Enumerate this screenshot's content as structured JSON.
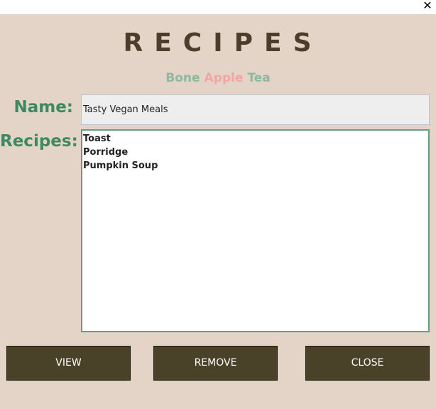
{
  "window": {
    "close_glyph": "✕"
  },
  "header": {
    "title": "RECIPES",
    "subtitle": {
      "word1": "Bone",
      "word2": "Apple",
      "word3": "Tea"
    }
  },
  "colors": {
    "background": "#e4d4c8",
    "label_green": "#3b8a62",
    "title_brown": "#4b3f2c",
    "bone": "#8fb8a2",
    "apple": "#f4a3a6",
    "tea": "#8fb8a2",
    "button_bg": "#4a4129"
  },
  "form": {
    "name_label": "Name:",
    "name_value": "Tasty Vegan Meals",
    "recipes_label": "Recipes:",
    "recipes": [
      "Toast",
      "Porridge",
      "Pumpkin Soup"
    ]
  },
  "buttons": {
    "view": "VIEW",
    "remove": "REMOVE",
    "close": "CLOSE"
  }
}
